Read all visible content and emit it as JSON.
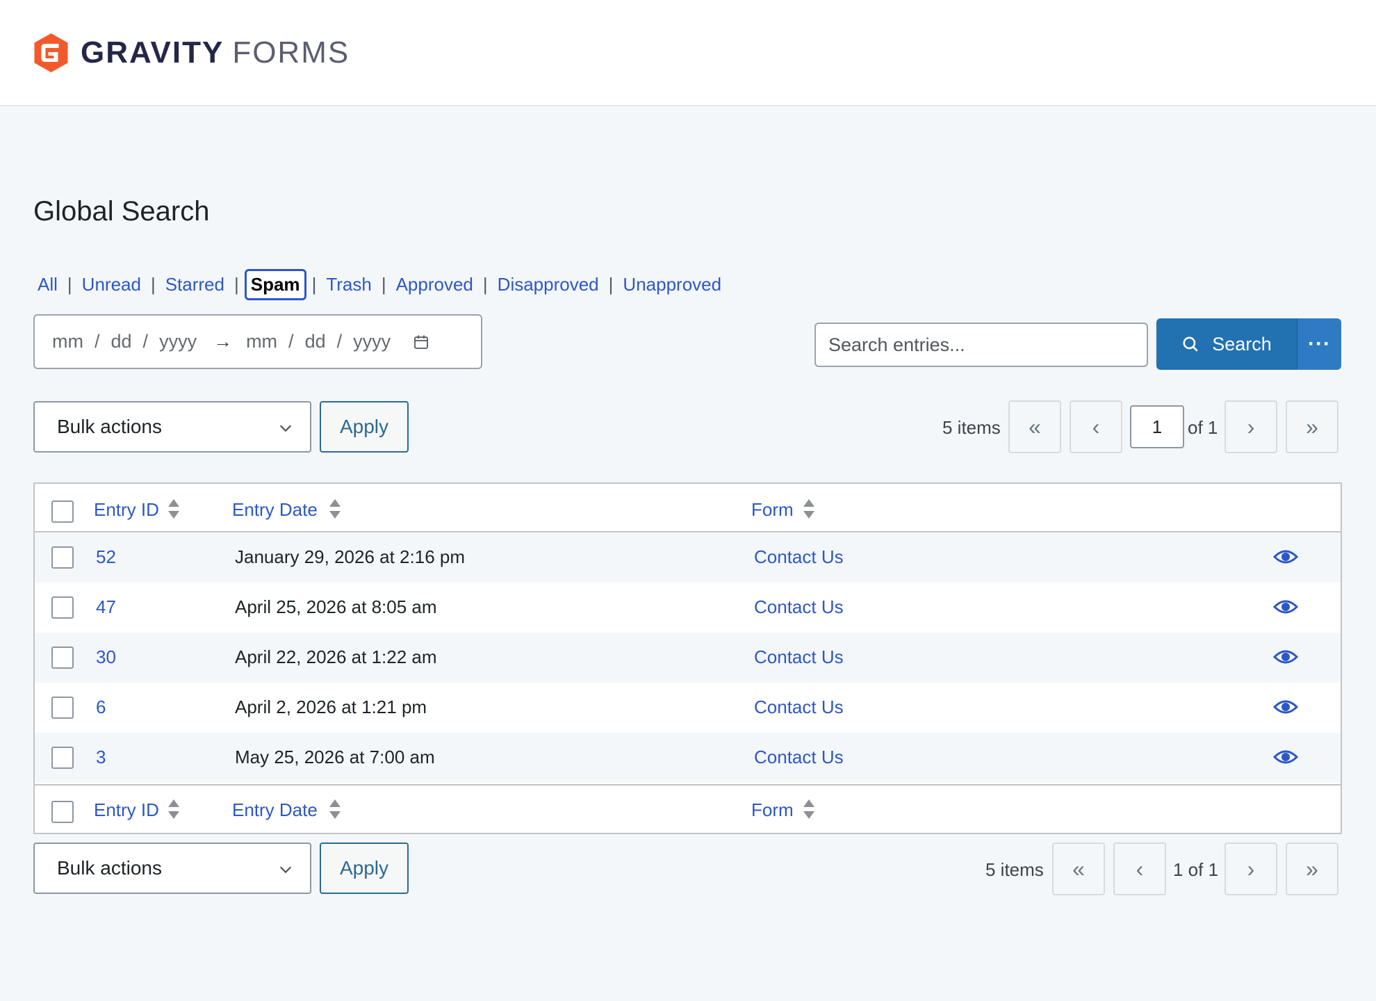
{
  "brand": {
    "word1": "GRAVITY",
    "word2": "FORMS",
    "accent": "#f15a2b"
  },
  "page_title": "Global Search",
  "filters": [
    {
      "label": "All",
      "current": false
    },
    {
      "label": "Unread",
      "current": false
    },
    {
      "label": "Starred",
      "current": false
    },
    {
      "label": "Spam",
      "current": true
    },
    {
      "label": "Trash",
      "current": false
    },
    {
      "label": "Approved",
      "current": false
    },
    {
      "label": "Disapproved",
      "current": false
    },
    {
      "label": "Unapproved",
      "current": false
    }
  ],
  "date_range": {
    "start": {
      "mm": "mm",
      "dd": "dd",
      "yyyy": "yyyy"
    },
    "end": {
      "mm": "mm",
      "dd": "dd",
      "yyyy": "yyyy"
    },
    "calendar_icon": "calendar-icon"
  },
  "search": {
    "placeholder": "Search entries...",
    "button_label": "Search",
    "more_icon": "ellipsis-icon"
  },
  "bulk": {
    "label": "Bulk actions",
    "apply": "Apply"
  },
  "pagination": {
    "items": "5 items",
    "current_page": "1",
    "of_label": "of 1",
    "bottom_label": "1 of 1",
    "first": "«",
    "prev": "‹",
    "next": "›",
    "last": "»"
  },
  "table": {
    "columns": {
      "entry_id": "Entry ID",
      "entry_date": "Entry Date",
      "form": "Form"
    },
    "rows": [
      {
        "id": "52",
        "date": "January 29, 2026 at 2:16 pm",
        "form": "Contact Us"
      },
      {
        "id": "47",
        "date": "April 25, 2026 at 8:05 am",
        "form": "Contact Us"
      },
      {
        "id": "30",
        "date": "April 22, 2026 at 1:22 am",
        "form": "Contact Us"
      },
      {
        "id": "6",
        "date": "April 2, 2026 at 1:21 pm",
        "form": "Contact Us"
      },
      {
        "id": "3",
        "date": "May 25, 2026 at 7:00 am",
        "form": "Contact Us"
      }
    ]
  },
  "colors": {
    "link": "#2c57c9",
    "primary_button": "#2271b1"
  }
}
